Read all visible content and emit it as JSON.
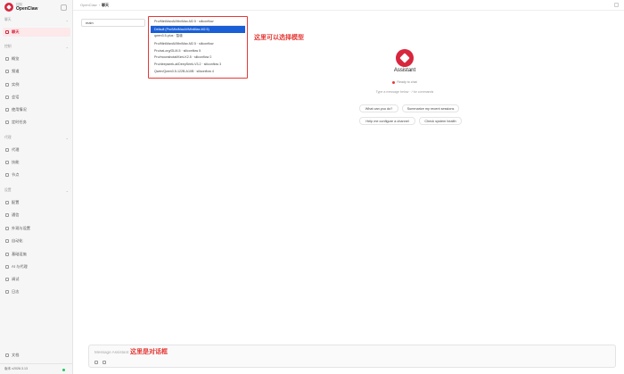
{
  "brand": {
    "sub": "控制",
    "name": "OpenClaw"
  },
  "sidebar": {
    "sections": [
      {
        "title": "聊天",
        "items": [
          {
            "label": "聊天",
            "active": true
          }
        ]
      },
      {
        "title": "控制",
        "items": [
          {
            "label": "概览"
          },
          {
            "label": "频道"
          },
          {
            "label": "实例"
          },
          {
            "label": "会话"
          },
          {
            "label": "使用情况"
          },
          {
            "label": "定时任务"
          }
        ]
      },
      {
        "title": "代理",
        "items": [
          {
            "label": "代理"
          },
          {
            "label": "技能"
          },
          {
            "label": "节点"
          }
        ]
      },
      {
        "title": "设置",
        "items": [
          {
            "label": "配置"
          },
          {
            "label": "通信"
          },
          {
            "label": "外观与设置"
          },
          {
            "label": "自动化"
          },
          {
            "label": "基础设施"
          },
          {
            "label": "AI 与代理"
          },
          {
            "label": "调试"
          },
          {
            "label": "日志"
          }
        ]
      }
    ],
    "docs": "文档",
    "version": "版本  v2026.3.13"
  },
  "topbar": {
    "crumb_root": "OpenClaw",
    "separator": "›",
    "crumb_current": "聊天"
  },
  "session": {
    "value": "main"
  },
  "models": {
    "items": [
      "Pro/MiniMaxAI/MiniMax-M2.5 · siliconflow",
      "Default (Pro/MiniMaxAI/MiniMax-M2.5)",
      "qwen3.5-plus · 智谱",
      "Pro/MiniMaxAI/MiniMax-M2.5 · siliconflow",
      "Pro/zai-org/GLM-5 · siliconflow 5",
      "Pro/moonshotai/Kimi-K2.5 · siliconflow 2",
      "Pro/deepseek-ai/DeepSeek-V3.2 · siliconflow 3",
      "Qwen/Qwen3.5-122B-A10B · siliconflow 4"
    ],
    "selected_index": 1,
    "annotation": "这里可以选择模型"
  },
  "assistant": {
    "name": "Assistant",
    "status": "Ready to chat",
    "hint": "Type a message below · / for commands",
    "chips": [
      "What can you do?",
      "Summarize my recent sessions",
      "Help me configure a channel",
      "Check system health"
    ]
  },
  "composer": {
    "placeholder": "Message Assistant",
    "annotation": "这里是对话框"
  },
  "colors": {
    "accent": "#d7263d",
    "selection": "#1a5fd6",
    "annotation": "#e53935",
    "online": "#22c55e"
  }
}
